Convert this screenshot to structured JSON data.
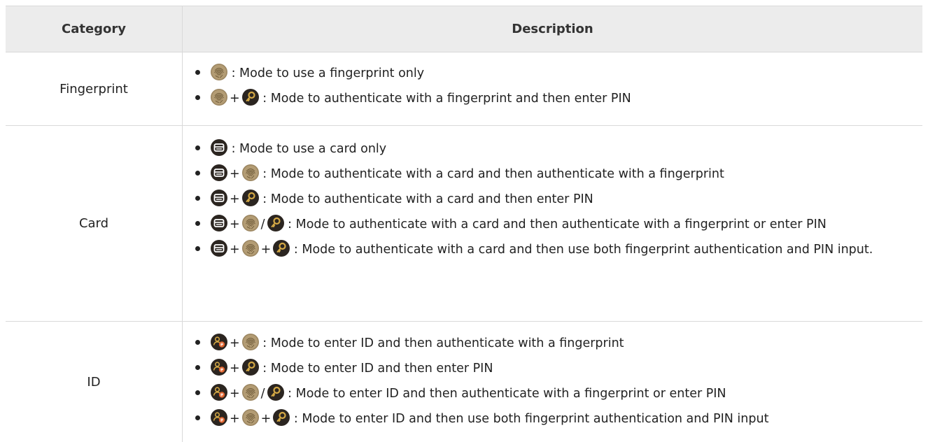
{
  "header": {
    "category": "Category",
    "description": "Description"
  },
  "rows": {
    "fingerprint": {
      "category": "Fingerprint",
      "items": [
        {
          "icons": [
            "fingerprint-icon"
          ],
          "text": ": Mode to use a fingerprint only"
        },
        {
          "icons": [
            "fingerprint-icon",
            "key-icon"
          ],
          "text": ": Mode to authenticate with a fingerprint and then enter PIN"
        }
      ]
    },
    "card": {
      "category": "Card",
      "items": [
        {
          "icons": [
            "card-icon"
          ],
          "text": ": Mode to use a card only"
        },
        {
          "icons": [
            "card-icon",
            "fingerprint-icon"
          ],
          "text": ": Mode to authenticate with a card and then authenticate with a fingerprint"
        },
        {
          "icons": [
            "card-icon",
            "key-icon"
          ],
          "text": ": Mode to authenticate with a card and then enter PIN"
        },
        {
          "icons": [
            "card-icon",
            "fingerprint-icon",
            "key-icon"
          ],
          "text": ": Mode to authenticate with a card and then authenticate with a fingerprint or enter PIN"
        },
        {
          "icons": [
            "card-icon",
            "fingerprint-icon",
            "key-icon"
          ],
          "text": ": Mode to authenticate with a card and then use both fingerprint authentication and PIN input."
        }
      ]
    },
    "id": {
      "category": "ID",
      "items": [
        {
          "icons": [
            "user-id-icon",
            "fingerprint-icon"
          ],
          "text": ": Mode to enter ID and then authenticate with a fingerprint"
        },
        {
          "icons": [
            "user-id-icon",
            "key-icon"
          ],
          "text": ": Mode to enter ID and then enter PIN"
        },
        {
          "icons": [
            "user-id-icon",
            "fingerprint-icon",
            "key-icon"
          ],
          "text": ": Mode to enter ID and then authenticate with a fingerprint or enter PIN"
        },
        {
          "icons": [
            "user-id-icon",
            "fingerprint-icon",
            "key-icon"
          ],
          "text": ": Mode to enter ID and then use both fingerprint authentication and PIN input"
        }
      ]
    }
  },
  "operators": {
    "plus": "+",
    "slash": "/"
  },
  "colors": {
    "header_bg": "#ececec",
    "border": "#d9d9d9",
    "icon_dark": "#2b2520",
    "icon_gold": "#c49a3a",
    "fingerprint_bg": "#a08a62"
  }
}
